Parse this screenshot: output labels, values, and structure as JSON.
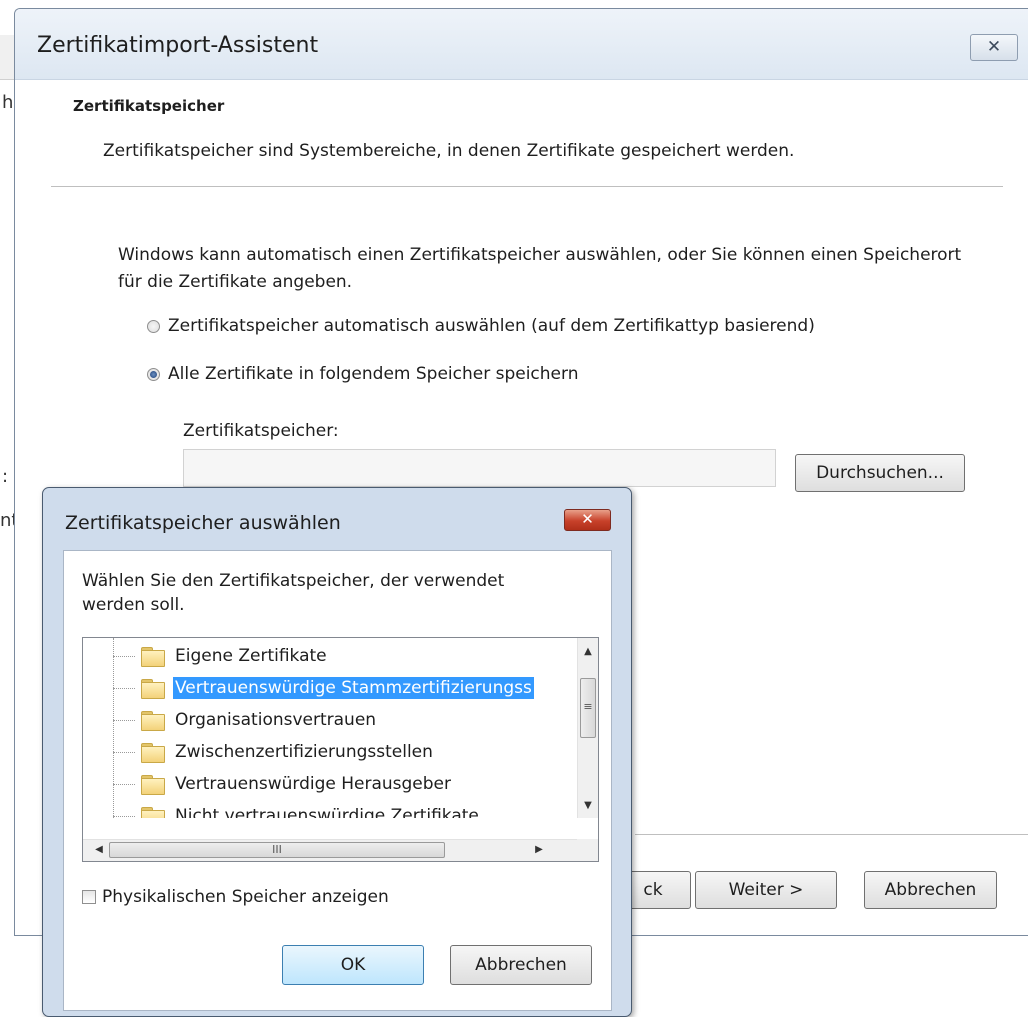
{
  "wizard": {
    "title": "Zertifikatimport-Assistent",
    "close_glyph": "✕",
    "heading": "Zertifikatspeicher",
    "subheading": "Zertifikatspeicher sind Systembereiche, in denen Zertifikate gespeichert werden.",
    "description": "Windows kann automatisch einen Zertifikatspeicher auswählen, oder Sie können einen Speicherort für die Zertifikate angeben.",
    "radio_auto_label": "Zertifikatspeicher automatisch auswählen (auf dem Zertifikattyp basierend)",
    "radio_manual_label": "Alle Zertifikate in folgendem Speicher speichern",
    "selected_option": "manual",
    "store_label": "Zertifikatspeicher:",
    "store_value": "",
    "browse_label": "Durchsuchen...",
    "back_label": "ck",
    "next_label": "Weiter >",
    "cancel_label": "Abbrechen"
  },
  "dialog": {
    "title": "Zertifikatspeicher auswählen",
    "close_glyph": "✕",
    "prompt": "Wählen Sie den Zertifikatspeicher, der verwendet werden soll.",
    "stores": [
      {
        "label": "Eigene Zertifikate",
        "selected": false
      },
      {
        "label": "Vertrauenswürdige Stammzertifizierungss",
        "selected": true
      },
      {
        "label": "Organisationsvertrauen",
        "selected": false
      },
      {
        "label": "Zwischenzertifizierungsstellen",
        "selected": false
      },
      {
        "label": "Vertrauenswürdige Herausgeber",
        "selected": false
      },
      {
        "label": "Nicht vertrauenswürdige Zertifikate",
        "selected": false
      }
    ],
    "physical_label": "Physikalischen Speicher anzeigen",
    "physical_checked": false,
    "ok_label": "OK",
    "cancel_label": "Abbrechen"
  },
  "background": {
    "chars": [
      "h",
      ":",
      "nt"
    ]
  }
}
